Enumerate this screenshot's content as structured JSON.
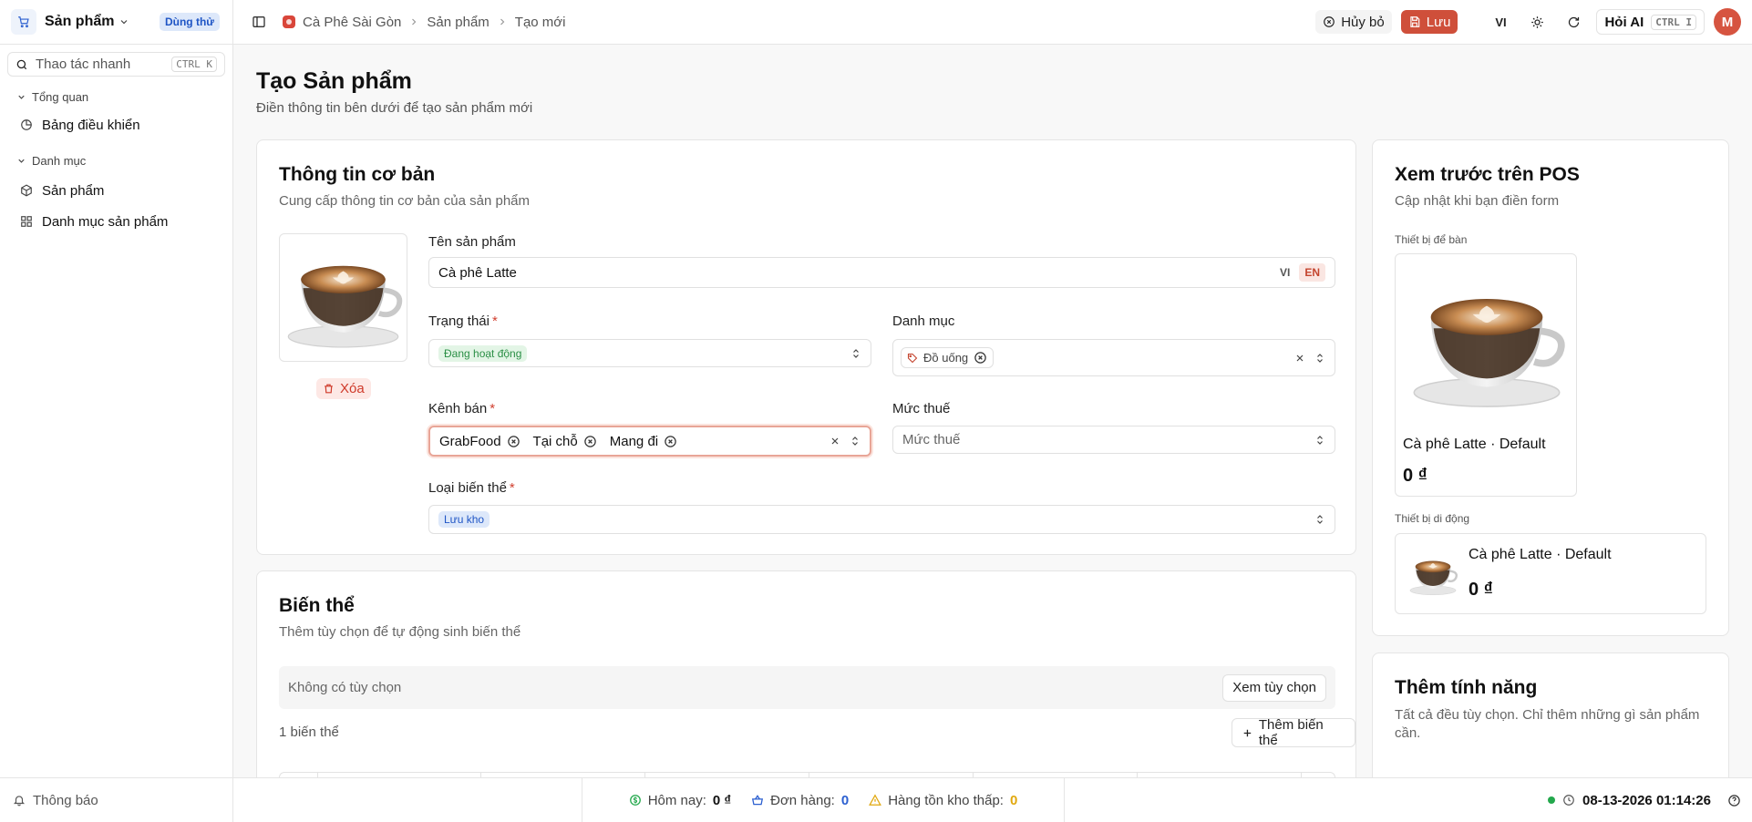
{
  "sidebar_header": {
    "title": "Sản phẩm",
    "trial_badge": "Dùng thử"
  },
  "breadcrumb": {
    "shop": "Cà Phê Sài Gòn",
    "section": "Sản phẩm",
    "current": "Tạo mới"
  },
  "toolbar": {
    "cancel_label": "Hủy bỏ",
    "save_label": "Lưu",
    "lang_label": "VI",
    "ai_label": "Hỏi AI",
    "ai_shortcut": "CTRL I",
    "avatar_initial": "M"
  },
  "sidebar": {
    "search_placeholder": "Thao tác nhanh",
    "search_shortcut": "CTRL K",
    "groups": [
      {
        "title": "Tổng quan",
        "items": [
          {
            "label": "Bảng điều khiển",
            "icon": "dashboard-icon"
          }
        ]
      },
      {
        "title": "Danh mục",
        "items": [
          {
            "label": "Sản phẩm",
            "icon": "box-icon"
          },
          {
            "label": "Danh mục sản phẩm",
            "icon": "grid-icon"
          }
        ]
      }
    ]
  },
  "page": {
    "title": "Tạo Sản phẩm",
    "subtitle": "Điền thông tin bên dưới để tạo sản phẩm mới"
  },
  "basic_info": {
    "title": "Thông tin cơ bản",
    "subtitle": "Cung cấp thông tin cơ bản của sản phẩm",
    "delete_label": "Xóa",
    "name_label": "Tên sản phẩm",
    "name_value": "Cà phê Latte",
    "lang_vi": "VI",
    "lang_en": "EN",
    "status_label": "Trạng thái",
    "status_value": "Đang hoạt động",
    "category_label": "Danh mục",
    "category_value": "Đồ uống",
    "channel_label": "Kênh bán",
    "channels": [
      "GrabFood",
      "Tại chỗ",
      "Mang đi"
    ],
    "tax_label": "Mức thuế",
    "tax_placeholder": "Mức thuế",
    "variant_type_label": "Loại biến thể",
    "variant_type_value": "Lưu kho"
  },
  "variants": {
    "title": "Biến thể",
    "subtitle": "Thêm tùy chọn để tự động sinh biến thể",
    "no_options": "Không có tùy chọn",
    "view_options_label": "Xem tùy chọn",
    "count_text": "1 biến thể",
    "add_variant_label": "Thêm biến thể"
  },
  "preview": {
    "title": "Xem trước trên POS",
    "subtitle": "Cập nhật khi bạn điền form",
    "desktop_label": "Thiết bị để bàn",
    "mobile_label": "Thiết bị di động",
    "product_line": "Cà phê Latte · Default",
    "price": "0 ₫"
  },
  "features": {
    "title": "Thêm tính năng",
    "subtitle": "Tất cả đều tùy chọn. Chỉ thêm những gì sản phẩm cần."
  },
  "statusbar": {
    "notifications": "Thông báo",
    "today_label": "Hôm nay:",
    "today_value": "0 ₫",
    "orders_label": "Đơn hàng:",
    "orders_value": "0",
    "low_stock_label": "Hàng tồn kho thấp:",
    "low_stock_value": "0",
    "datetime": "08-13-2026 01:14:26"
  },
  "colors": {
    "accent": "#cf4f3a",
    "success": "#23a84c",
    "info": "#1f55c5",
    "warning": "#e1a80f"
  }
}
